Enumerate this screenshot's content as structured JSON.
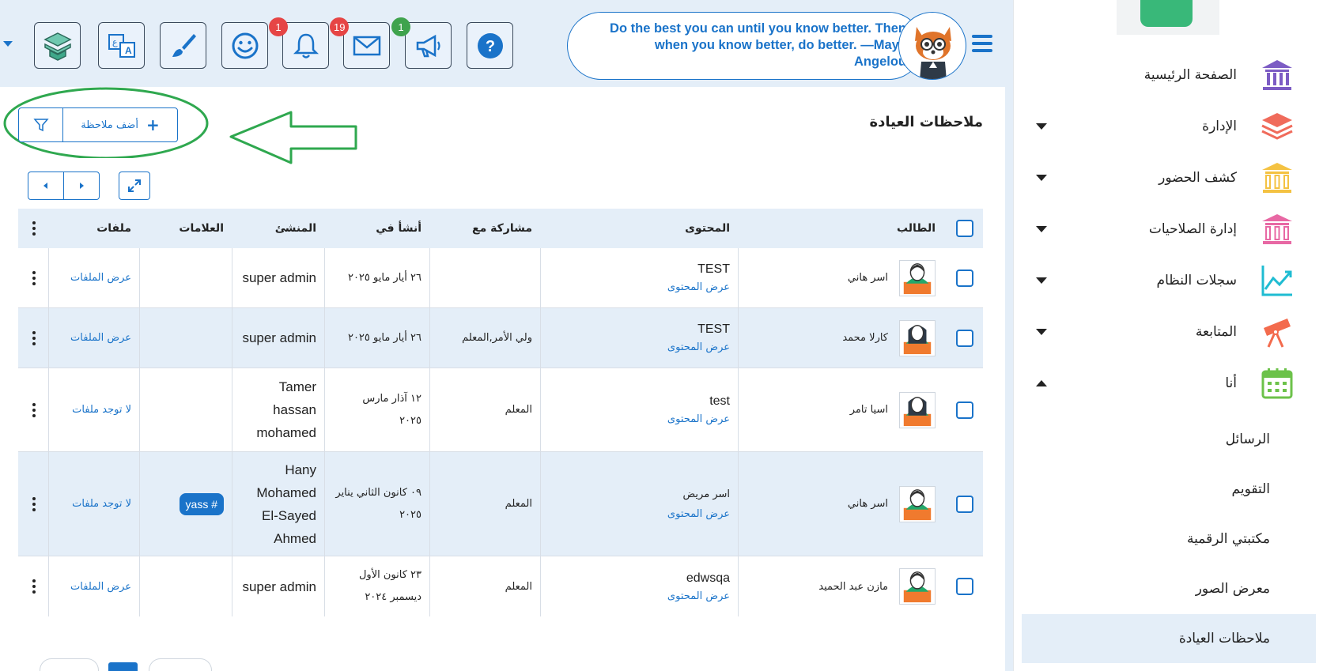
{
  "header": {
    "quote": "Do the best you can until you know better. Then when you know better, do better. —Maya Angelou",
    "badges": {
      "notifications": "1",
      "messages": "19",
      "announcements": "1"
    },
    "colors": {
      "accent": "#1a73c9",
      "badge_red": "#e64545",
      "badge_green": "#3fa34d",
      "header_bg": "#e4eef8"
    }
  },
  "page": {
    "title": "ملاحظات العيادة",
    "add_note_label": "أضف ملاحظة"
  },
  "table": {
    "headers": {
      "student": "الطالب",
      "content": "المحتوى",
      "shared_with": "مشاركة مع",
      "created_at": "أنشأ في",
      "creator": "المنشئ",
      "tags": "العلامات",
      "files": "ملفات"
    },
    "view_content_label": "عرض المحتوى",
    "rows": [
      {
        "student": "اسر هاني",
        "content": "TEST",
        "shared_with": "",
        "created_line1": "٢٦ أيار مايو ٢٠٢٥",
        "created_line2": "",
        "creator": [
          "super admin"
        ],
        "tag": "",
        "files": "عرض الملفات"
      },
      {
        "student": "كارلا محمد",
        "content": "TEST",
        "shared_with": "ولي الأمر,المعلم",
        "created_line1": "٢٦ أيار مايو ٢٠٢٥",
        "created_line2": "",
        "creator": [
          "super admin"
        ],
        "tag": "",
        "files": "عرض الملفات"
      },
      {
        "student": "اسيا تامر",
        "content": "test",
        "shared_with": "المعلم",
        "created_line1": "١٢ آذار مارس",
        "created_line2": "٢٠٢٥",
        "creator": [
          "Tamer",
          "hassan",
          "mohamed"
        ],
        "tag": "",
        "files": "لا توجد ملفات"
      },
      {
        "student": "اسر هاني",
        "content": "اسر مريض",
        "shared_with": "المعلم",
        "created_line1": "٠٩ كانون الثاني يناير",
        "created_line2": "٢٠٢٥",
        "creator": [
          "Hany",
          "Mohamed",
          "El-Sayed",
          "Ahmed"
        ],
        "tag": "yass #",
        "files": "لا توجد ملفات"
      },
      {
        "student": "مازن عبد الحميد",
        "content": "edwsqa",
        "shared_with": "المعلم",
        "created_line1": "٢٣ كانون الأول",
        "created_line2": "ديسمبر ٢٠٢٤",
        "creator": [
          "super admin"
        ],
        "tag": "",
        "files": "عرض الملفات"
      }
    ]
  },
  "sidebar": {
    "items": [
      {
        "label": "الصفحة الرئيسية",
        "icon": "bank-building-icon",
        "color": "#7c5cc4",
        "arrow": ""
      },
      {
        "label": "الإدارة",
        "icon": "layers-stack-icon",
        "color": "#f06b5b",
        "arrow": "down"
      },
      {
        "label": "كشف الحضور",
        "icon": "columns-building-icon",
        "color": "#f4c242",
        "arrow": "down"
      },
      {
        "label": "إدارة الصلاحيات",
        "icon": "columns-building-icon",
        "color": "#e868a4",
        "arrow": "down"
      },
      {
        "label": "سجلات النظام",
        "icon": "trend-chart-icon",
        "color": "#1fbcd2",
        "arrow": "down"
      },
      {
        "label": "المتابعة",
        "icon": "telescope-icon",
        "color": "#f36b4d",
        "arrow": "down"
      },
      {
        "label": "أنا",
        "icon": "calendar-icon",
        "color": "#6cc24a",
        "arrow": "up"
      }
    ],
    "sub_items": [
      {
        "label": "الرسائل",
        "active": false
      },
      {
        "label": "التقويم",
        "active": false
      },
      {
        "label": "مكتبتي الرقمية",
        "active": false
      },
      {
        "label": "معرض الصور",
        "active": false
      },
      {
        "label": "ملاحظات العيادة",
        "active": true
      }
    ]
  }
}
